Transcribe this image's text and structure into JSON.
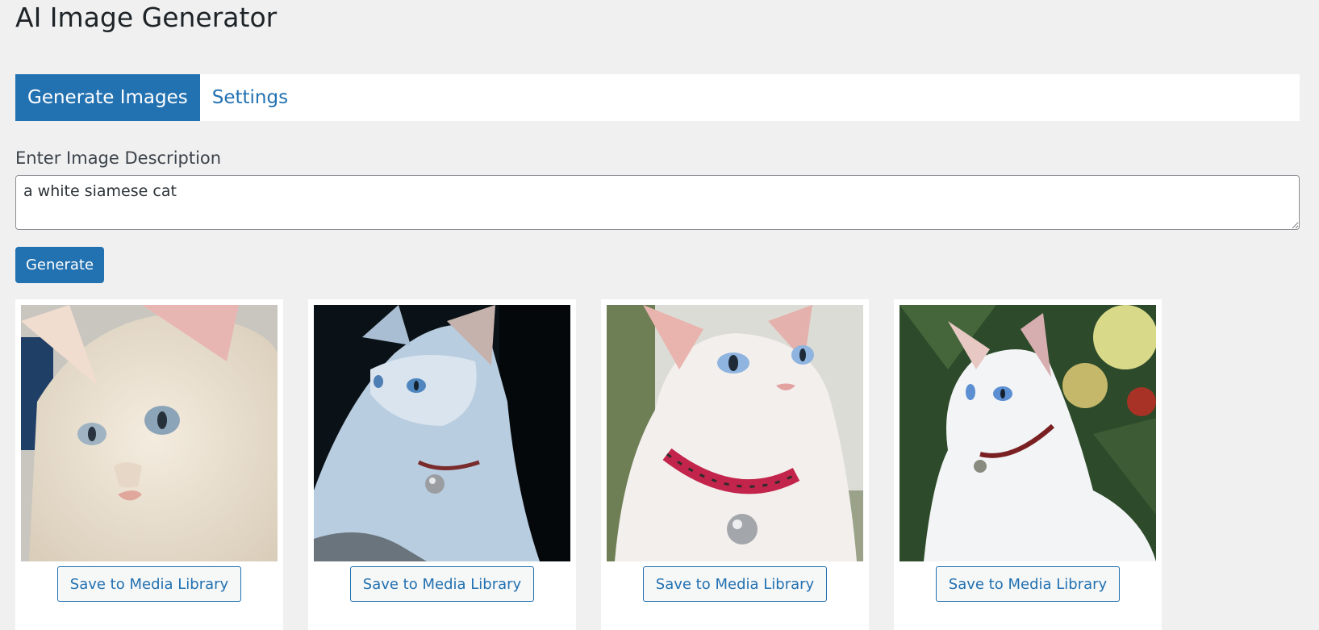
{
  "page": {
    "title": "AI Image Generator"
  },
  "tabs": [
    {
      "label": "Generate Images",
      "active": true
    },
    {
      "label": "Settings",
      "active": false
    }
  ],
  "form": {
    "description_label": "Enter Image Description",
    "description_value": "a white siamese cat",
    "generate_label": "Generate"
  },
  "gallery": {
    "images": [
      {
        "subject": "white siamese cat close-up portrait",
        "save_label": "Save to Media Library"
      },
      {
        "subject": "white siamese cat lying on dark background",
        "save_label": "Save to Media Library"
      },
      {
        "subject": "white siamese cat with red collar and bell",
        "save_label": "Save to Media Library"
      },
      {
        "subject": "white siamese cat sitting among green foliage",
        "save_label": "Save to Media Library"
      }
    ]
  },
  "colors": {
    "accent": "#2271b1",
    "background": "#f0f0f1",
    "text": "#1d2327"
  }
}
